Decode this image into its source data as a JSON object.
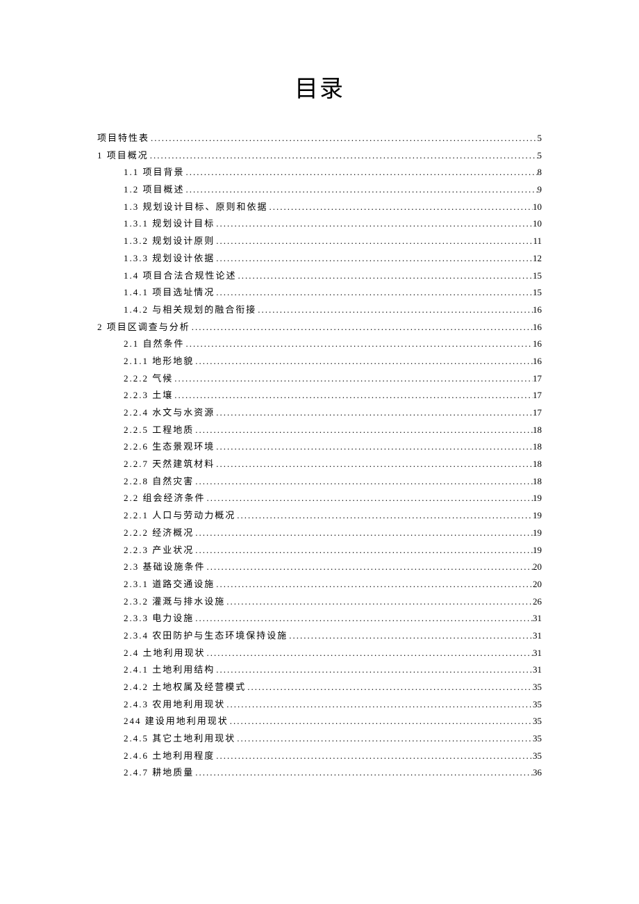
{
  "title": "目录",
  "entries": [
    {
      "level": 0,
      "label": "项目特性表",
      "page": "5"
    },
    {
      "level": 0,
      "label": "1 项目概况",
      "page": "5"
    },
    {
      "level": 1,
      "label": "1.1  项目背景",
      "page": "8"
    },
    {
      "level": 1,
      "label": "1.2  项目概述",
      "page": "9"
    },
    {
      "level": 1,
      "label": "1.3  规划设计目标、原则和依据",
      "page": "10"
    },
    {
      "level": 1,
      "label": "1.3.1 规划设计目标",
      "page": "10"
    },
    {
      "level": 1,
      "label": "1.3.2 规划设计原则",
      "page": "11"
    },
    {
      "level": 1,
      "label": "1.3.3 规划设计依据",
      "page": "12"
    },
    {
      "level": 1,
      "label": "1.4  项目合法合规性论述",
      "page": "15"
    },
    {
      "level": 1,
      "label": "1.4.1 项目选址情况",
      "page": "15"
    },
    {
      "level": 1,
      "label": "1.4.2 与相关规划的融合衔接",
      "page": "16"
    },
    {
      "level": 0,
      "label": "2 项目区调查与分析",
      "page": "16"
    },
    {
      "level": 1,
      "label": "2.1  自然条件",
      "page": "16"
    },
    {
      "level": 1,
      "label": "2.1.1 地形地貌",
      "page": "16"
    },
    {
      "level": 1,
      "label": "2.2.2 气候",
      "page": "17"
    },
    {
      "level": 1,
      "label": "2.2.3 土壤",
      "page": "17"
    },
    {
      "level": 1,
      "label": "2.2.4 水文与水资源",
      "page": "17"
    },
    {
      "level": 1,
      "label": "2.2.5 工程地质",
      "page": "18"
    },
    {
      "level": 1,
      "label": "2.2.6 生态景观环境",
      "page": "18"
    },
    {
      "level": 1,
      "label": "2.2.7 天然建筑材料",
      "page": "18"
    },
    {
      "level": 1,
      "label": "2.2.8 自然灾害",
      "page": "18"
    },
    {
      "level": 1,
      "label": "2.2  组会经济条件",
      "page": "19"
    },
    {
      "level": 1,
      "label": "2.2.1 人口与劳动力概况",
      "page": "19"
    },
    {
      "level": 1,
      "label": "2.2.2 经济概况",
      "page": "19"
    },
    {
      "level": 1,
      "label": "2.2.3 产业状况",
      "page": "19"
    },
    {
      "level": 1,
      "label": "2.3  基础设施条件",
      "page": "20"
    },
    {
      "level": 1,
      "label": "2.3.1 道路交通设施",
      "page": "20"
    },
    {
      "level": 1,
      "label": "2.3.2 灌溉与排水设施",
      "page": "26"
    },
    {
      "level": 1,
      "label": "2.3.3 电力设施",
      "page": "31"
    },
    {
      "level": 1,
      "label": "2.3.4 农田防护与生态环境保持设施",
      "page": "31"
    },
    {
      "level": 1,
      "label": "2.4  土地利用现状",
      "page": "31"
    },
    {
      "level": 1,
      "label": "2.4.1 土地利用结构",
      "page": "31"
    },
    {
      "level": 1,
      "label": "2.4.2 土地权属及经营模式",
      "page": "35"
    },
    {
      "level": 1,
      "label": "2.4.3 农用地利用现状",
      "page": "35"
    },
    {
      "level": 1,
      "label": "244 建设用地利用现状",
      "page": "35"
    },
    {
      "level": 1,
      "label": "2.4.5 其它土地利用现状",
      "page": "35"
    },
    {
      "level": 1,
      "label": "2.4.6 土地利用程度",
      "page": "35"
    },
    {
      "level": 1,
      "label": "2.4.7 耕地质量",
      "page": "36"
    }
  ]
}
